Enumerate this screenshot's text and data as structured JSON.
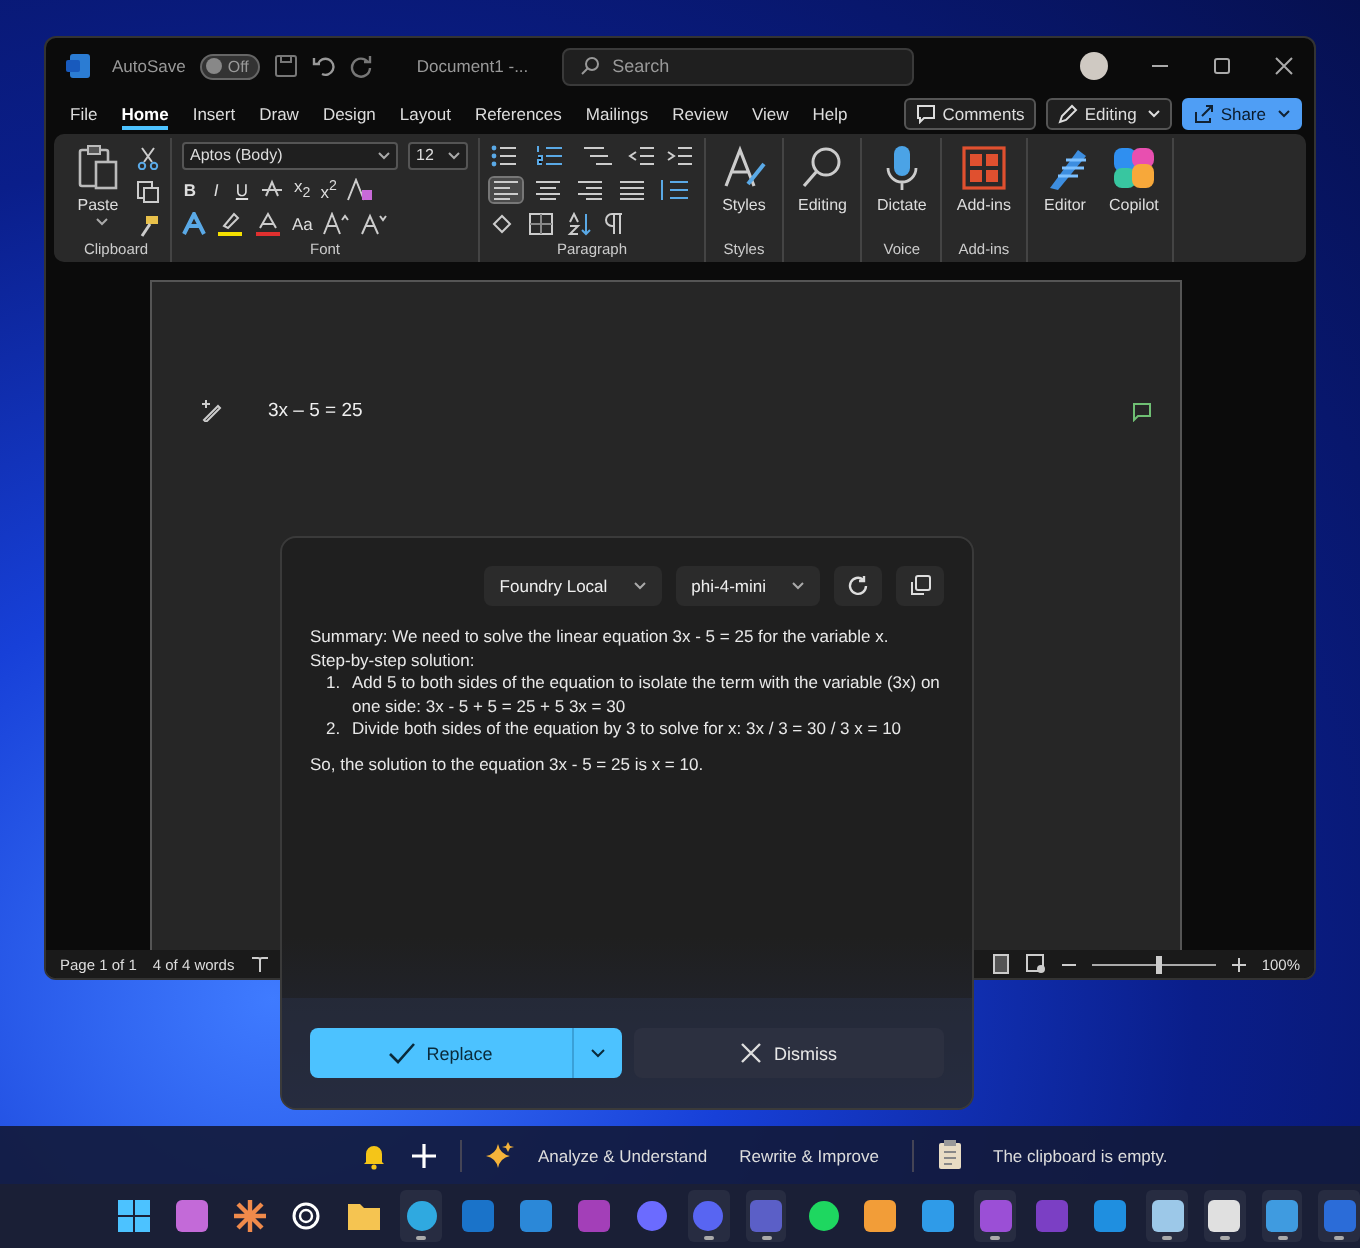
{
  "window": {
    "autosave": "AutoSave",
    "autosave_toggle": {
      "text": "Off",
      "on": false
    },
    "title": "Document1 -...",
    "search": {
      "placeholder": "Search"
    }
  },
  "menu_tabs": [
    {
      "label": "File",
      "selected": false
    },
    {
      "label": "Home",
      "selected": true
    },
    {
      "label": "Insert",
      "selected": false
    },
    {
      "label": "Draw",
      "selected": false
    },
    {
      "label": "Design",
      "selected": false
    },
    {
      "label": "Layout",
      "selected": false
    },
    {
      "label": "References",
      "selected": false
    },
    {
      "label": "Mailings",
      "selected": false
    },
    {
      "label": "Review",
      "selected": false
    },
    {
      "label": "View",
      "selected": false
    },
    {
      "label": "Help",
      "selected": false
    }
  ],
  "header_buttons": [
    {
      "kind": "comments",
      "label": "Comments"
    },
    {
      "kind": "editing",
      "label": "Editing"
    },
    {
      "kind": "share",
      "label": "Share"
    }
  ],
  "ribbon": [
    {
      "kind": "clipboard",
      "label": "Clipboard",
      "button": "Paste"
    },
    {
      "kind": "font",
      "label": "Font",
      "family": "Aptos (Body)",
      "size": "12",
      "toggles": [
        "B",
        "I",
        "U"
      ],
      "scripts": [
        "x$_{2}$",
        "x$^{2}$"
      ],
      "case": "Aa"
    },
    {
      "kind": "paragraph",
      "label": "Paragraph",
      "alignments": [
        {
          "selected": true
        },
        {
          "selected": false
        },
        {
          "selected": false
        },
        {
          "selected": false
        }
      ]
    },
    {
      "kind": "big",
      "label": "Styles",
      "buttons": [
        {
          "kind": "styles",
          "text": "Styles"
        }
      ]
    },
    {
      "kind": "big",
      "buttons": [
        {
          "kind": "find",
          "text": "Editing"
        }
      ]
    },
    {
      "kind": "big",
      "label": "Voice",
      "buttons": [
        {
          "kind": "dictate",
          "text": "Dictate"
        }
      ]
    },
    {
      "kind": "big",
      "label": "Add-ins",
      "buttons": [
        {
          "kind": "addins",
          "text": "Add-ins"
        }
      ]
    },
    {
      "kind": "big",
      "buttons": [
        {
          "kind": "editor",
          "text": "Editor"
        },
        {
          "kind": "copilot",
          "text": "Copilot"
        }
      ]
    }
  ],
  "document": {
    "text": "3x – 5 = 25"
  },
  "status_bar": {
    "page": "Page 1 of 1",
    "words": "4 of 4 words",
    "zoom": {
      "level": 0.55,
      "reading": "100%"
    }
  },
  "ai_panel": {
    "provider": "Foundry Local",
    "model": "phi-4-mini",
    "summary": "Summary: We need to solve the linear equation 3x - 5 = 25 for the variable x.",
    "heading": "Step-by-step solution:",
    "steps": [
      {
        "number": "1.",
        "text": "Add 5 to both sides of the equation to isolate the term with the variable (3x) on one side: 3x - 5 + 5 = 25 + 5 3x = 30"
      },
      {
        "number": "2.",
        "text": "Divide both sides of the equation by 3 to solve for x: 3x / 3 = 30 / 3 x = 10"
      }
    ],
    "conclusion": "So, the solution to the equation 3x - 5 = 25 is x = 10.",
    "primary_button": "Replace",
    "secondary_button": "Dismiss"
  },
  "assistant_bar": {
    "actions": [
      "Analyze & Understand",
      "Rewrite & Improve"
    ],
    "clipboard": "The clipboard is empty."
  },
  "taskbar": [
    {
      "running": false
    },
    {
      "running": false
    },
    {
      "running": false
    },
    {
      "running": false
    },
    {
      "running": false
    },
    {
      "running": true
    },
    {
      "running": false
    },
    {
      "running": false
    },
    {
      "running": false
    },
    {
      "running": false
    },
    {
      "running": true
    },
    {
      "running": true
    },
    {
      "running": false
    },
    {
      "running": false
    },
    {
      "running": false
    },
    {
      "running": true
    },
    {
      "running": false
    },
    {
      "running": false
    },
    {
      "running": true
    },
    {
      "running": true
    },
    {
      "running": true
    },
    {
      "running": true
    }
  ]
}
